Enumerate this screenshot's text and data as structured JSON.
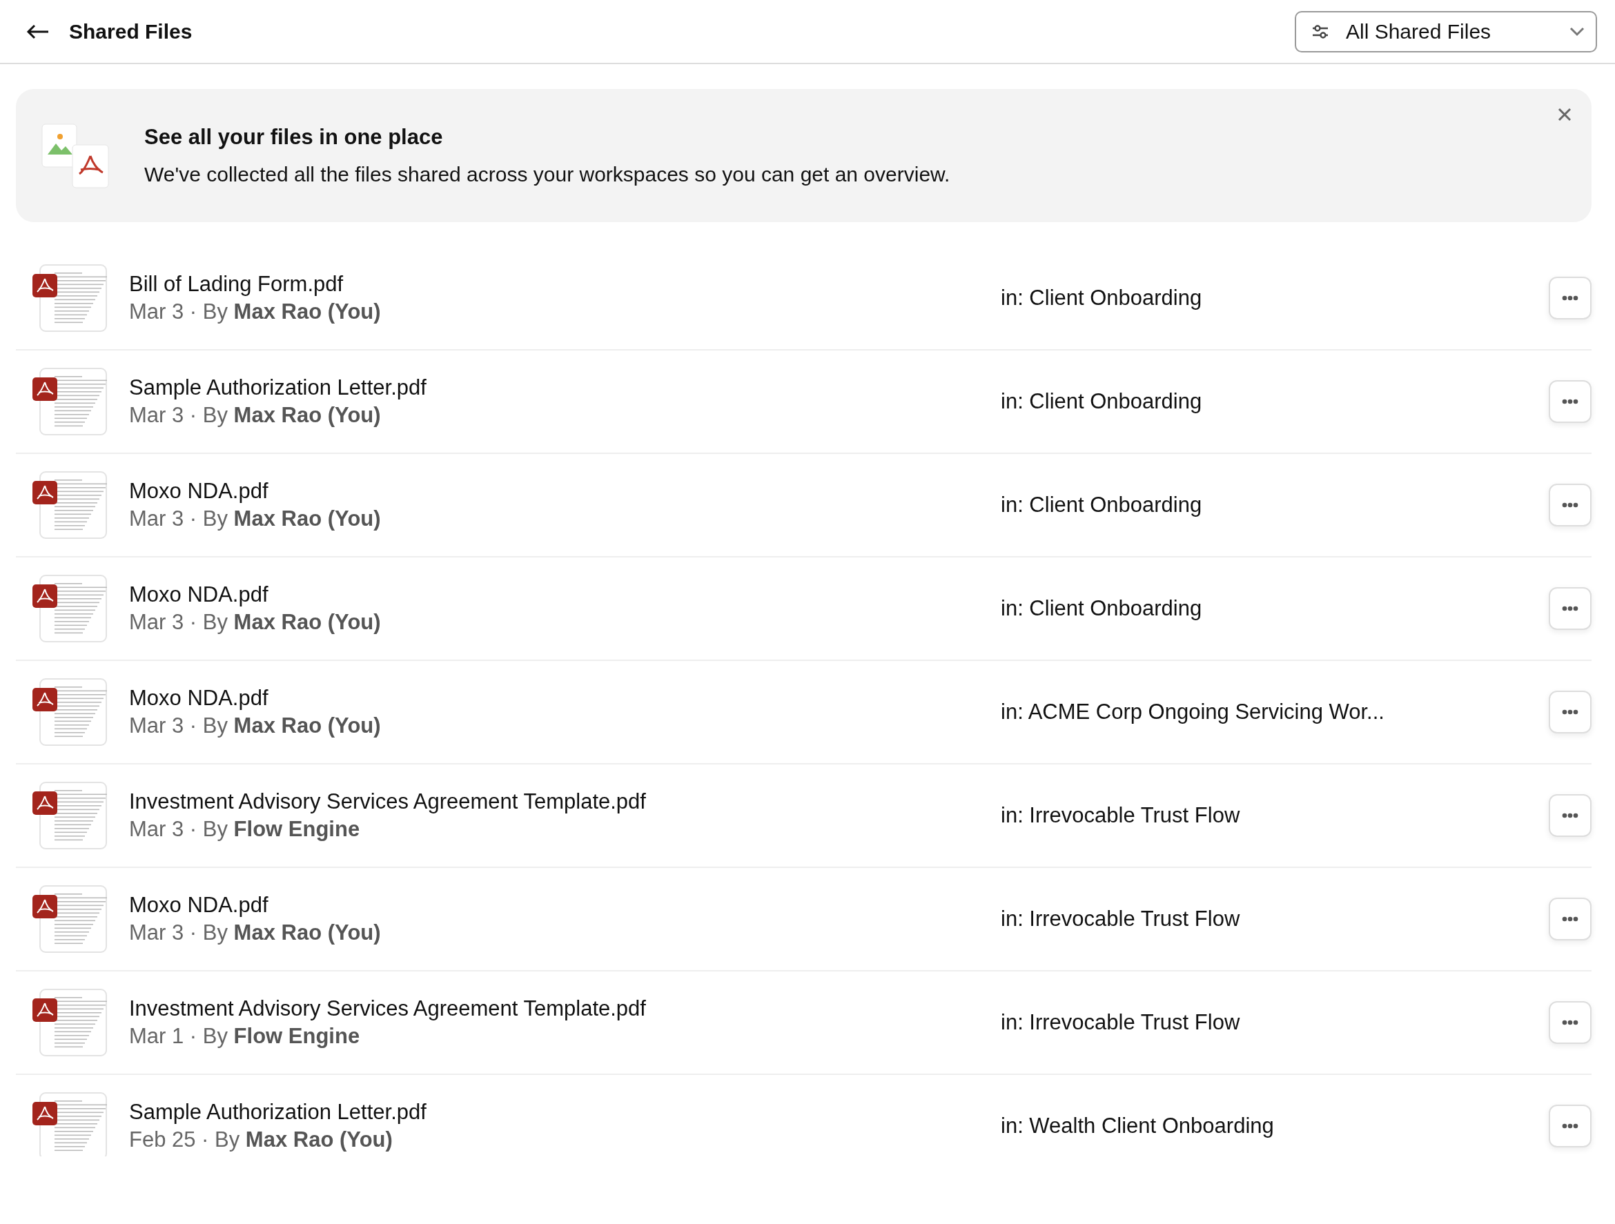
{
  "header": {
    "title": "Shared Files",
    "filter": {
      "label": "All Shared Files"
    }
  },
  "banner": {
    "title": "See all your files in one place",
    "text": "We've collected all the files shared across your workspaces so you can get an overview."
  },
  "files": [
    {
      "name": "Bill of Lading Form.pdf",
      "date": "Mar 3",
      "sep": "·",
      "by": "By",
      "author": "Max Rao (You)",
      "location": "in: Client Onboarding"
    },
    {
      "name": "Sample Authorization Letter.pdf",
      "date": "Mar 3",
      "sep": "·",
      "by": "By",
      "author": "Max Rao (You)",
      "location": "in: Client Onboarding"
    },
    {
      "name": "Moxo NDA.pdf",
      "date": "Mar 3",
      "sep": "·",
      "by": "By",
      "author": "Max Rao (You)",
      "location": "in: Client Onboarding"
    },
    {
      "name": "Moxo NDA.pdf",
      "date": "Mar 3",
      "sep": "·",
      "by": "By",
      "author": "Max Rao (You)",
      "location": "in: Client Onboarding"
    },
    {
      "name": "Moxo NDA.pdf",
      "date": "Mar 3",
      "sep": "·",
      "by": "By",
      "author": "Max Rao (You)",
      "location": "in: ACME Corp Ongoing Servicing Wor..."
    },
    {
      "name": "Investment Advisory Services Agreement Template.pdf",
      "date": "Mar 3",
      "sep": "·",
      "by": "By",
      "author": "Flow Engine",
      "location": "in: Irrevocable Trust Flow"
    },
    {
      "name": "Moxo NDA.pdf",
      "date": "Mar 3",
      "sep": "·",
      "by": "By",
      "author": "Max Rao (You)",
      "location": "in: Irrevocable Trust Flow"
    },
    {
      "name": "Investment Advisory Services Agreement Template.pdf",
      "date": "Mar 1",
      "sep": "·",
      "by": "By",
      "author": "Flow Engine",
      "location": "in: Irrevocable Trust Flow"
    },
    {
      "name": "Sample Authorization Letter.pdf",
      "date": "Feb 25",
      "sep": "·",
      "by": "By",
      "author": "Max Rao (You)",
      "location": "in: Wealth Client Onboarding"
    }
  ]
}
